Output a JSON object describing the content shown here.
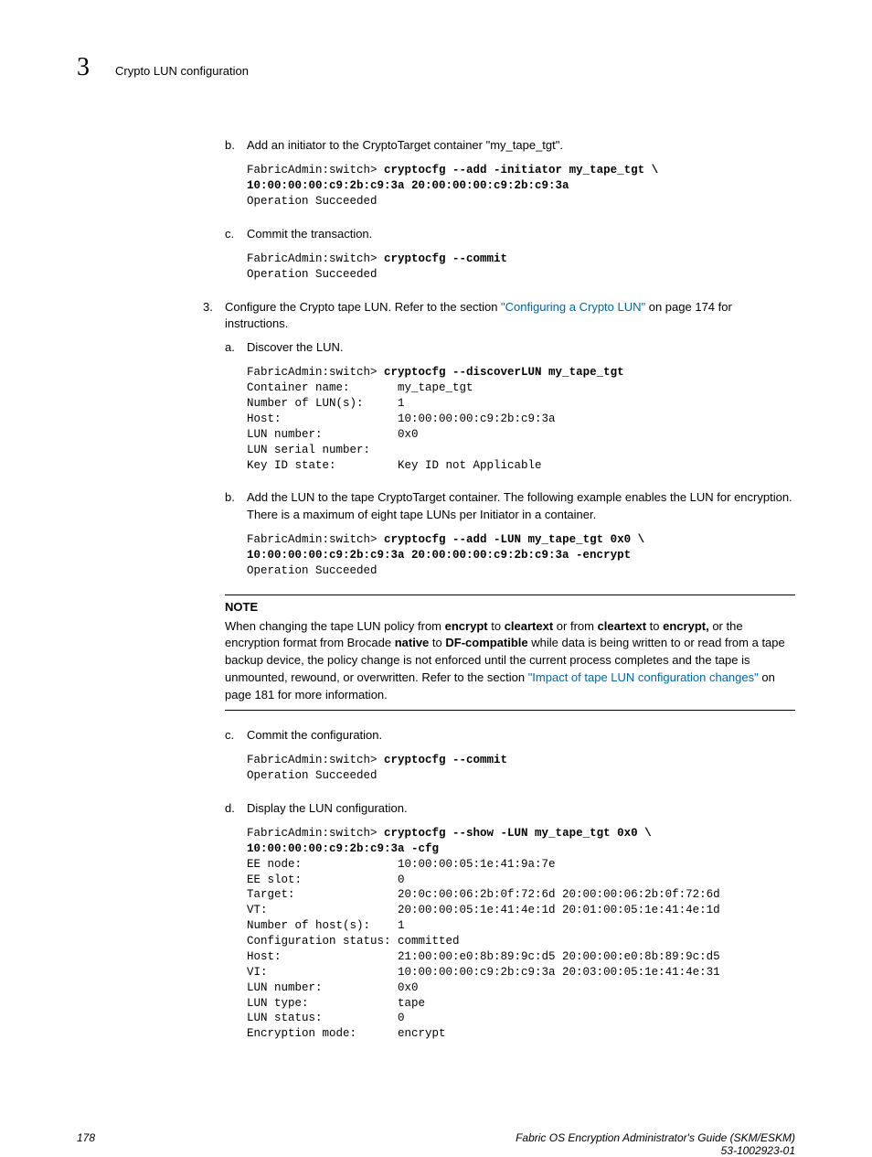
{
  "header": {
    "chapter_number": "3",
    "chapter_title": "Crypto LUN configuration"
  },
  "steps": {
    "s_b": {
      "marker": "b.",
      "text": "Add an initiator to the CryptoTarget container \"my_tape_tgt\"."
    },
    "code_b_prompt": "FabricAdmin:switch> ",
    "code_b_cmd": "cryptocfg --add -initiator my_tape_tgt \\\n10:00:00:00:c9:2b:c9:3a 20:00:00:00:c9:2b:c9:3a",
    "code_b_out": "\nOperation Succeeded",
    "s_c": {
      "marker": "c.",
      "text": "Commit the transaction."
    },
    "code_c_prompt": "FabricAdmin:switch> ",
    "code_c_cmd": "cryptocfg --commit",
    "code_c_out": "\nOperation Succeeded",
    "s_3": {
      "marker": "3.",
      "pre": "Configure the Crypto tape LUN. Refer to the section ",
      "link": "\"Configuring a Crypto LUN\"",
      "post": " on page 174 for instructions."
    },
    "s_3a": {
      "marker": "a.",
      "text": "Discover the LUN."
    },
    "code_3a_prompt": "FabricAdmin:switch> ",
    "code_3a_cmd": "cryptocfg --discoverLUN my_tape_tgt",
    "code_3a_out": "\nContainer name:       my_tape_tgt\nNumber of LUN(s):     1\nHost:                 10:00:00:00:c9:2b:c9:3a\nLUN number:           0x0\nLUN serial number:\nKey ID state:         Key ID not Applicable",
    "s_3b": {
      "marker": "b.",
      "text": "Add the LUN to the tape CryptoTarget container. The following example enables the LUN for encryption. There is a maximum of eight tape LUNs per Initiator in a container."
    },
    "code_3b_prompt": "FabricAdmin:switch> ",
    "code_3b_cmd": "cryptocfg --add -LUN my_tape_tgt 0x0 \\\n10:00:00:00:c9:2b:c9:3a 20:00:00:00:c9:2b:c9:3a -encrypt",
    "code_3b_out": "\nOperation Succeeded",
    "note": {
      "label": "NOTE",
      "t1": "When changing the tape LUN policy from ",
      "b1": "encrypt",
      "t2": " to ",
      "b2": "cleartext",
      "t3": " or from ",
      "b3": "cleartext",
      "t4": " to ",
      "b4": "encrypt,",
      "t5": " or the encryption format from Brocade ",
      "b5": "native",
      "t6": " to ",
      "b6": "DF-compatible",
      "t7": " while data is being written to or read from a tape backup device, the policy change is not enforced until the current process completes and the tape is unmounted, rewound, or overwritten. Refer to the section ",
      "link": "\"Impact of tape LUN configuration changes\"",
      "t8": " on page 181 for more information."
    },
    "s_3c": {
      "marker": "c.",
      "text": "Commit the configuration."
    },
    "code_3c_prompt": "FabricAdmin:switch> ",
    "code_3c_cmd": "cryptocfg --commit",
    "code_3c_out": "\nOperation Succeeded",
    "s_3d": {
      "marker": "d.",
      "text": "Display the LUN configuration."
    },
    "code_3d_prompt": "FabricAdmin:switch> ",
    "code_3d_cmd": "cryptocfg --show -LUN my_tape_tgt 0x0 \\\n10:00:00:00:c9:2b:c9:3a -cfg",
    "code_3d_out": "\nEE node:              10:00:00:05:1e:41:9a:7e\nEE slot:              0\nTarget:               20:0c:00:06:2b:0f:72:6d 20:00:00:06:2b:0f:72:6d\nVT:                   20:00:00:05:1e:41:4e:1d 20:01:00:05:1e:41:4e:1d\nNumber of host(s):    1\nConfiguration status: committed\nHost:                 21:00:00:e0:8b:89:9c:d5 20:00:00:e0:8b:89:9c:d5\nVI:                   10:00:00:00:c9:2b:c9:3a 20:03:00:05:1e:41:4e:31\nLUN number:           0x0\nLUN type:             tape\nLUN status:           0\nEncryption mode:      encrypt"
  },
  "footer": {
    "page": "178",
    "title": "Fabric OS Encryption Administrator's Guide (SKM/ESKM)",
    "docnum": "53-1002923-01"
  }
}
